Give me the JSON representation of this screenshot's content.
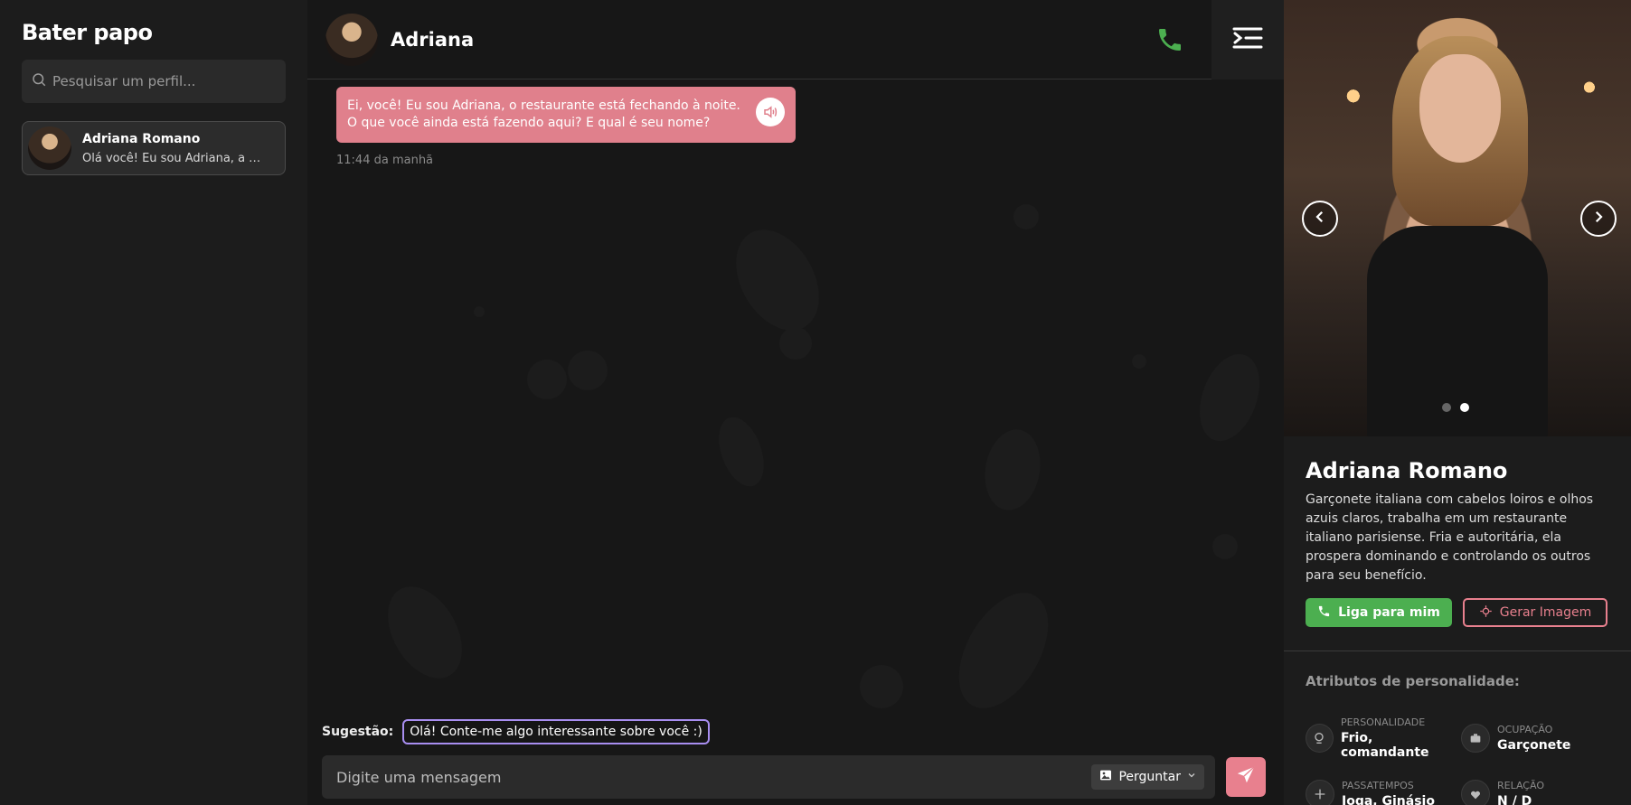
{
  "sidebar": {
    "title": "Bater papo",
    "search_placeholder": "Pesquisar um perfil...",
    "conversations": [
      {
        "name": "Adriana Romano",
        "preview": "Olá você! Eu sou Adriana, a r..."
      }
    ]
  },
  "chat": {
    "title": "Adriana",
    "messages": [
      {
        "text": "Ei, você! Eu sou Adriana, o restaurante está fechando à noite. O que você ainda está fazendo aqui? E qual é seu nome?",
        "time": "11:44 da manhã"
      }
    ],
    "suggestion_label": "Sugestão:",
    "suggestion_text": "Olá! Conte-me algo interessante sobre você :)",
    "input_placeholder": "Digite uma mensagem",
    "ask_label": "Perguntar"
  },
  "profile": {
    "name": "Adriana Romano",
    "description": "Garçonete italiana com cabelos loiros e olhos azuis claros, trabalha em um restaurante italiano parisiense. Fria e autoritária, ela prospera dominando e controlando os outros para seu benefício.",
    "call_label": "Liga para mim",
    "image_label": "Gerar Imagem",
    "attributes_title": "Atributos de personalidade:",
    "attributes": [
      {
        "key": "PERSONALIDADE",
        "value": "Frio, comandante",
        "icon": "personality-icon"
      },
      {
        "key": "OCUPAÇÃO",
        "value": "Garçonete",
        "icon": "occupation-icon"
      },
      {
        "key": "PASSATEMPOS",
        "value": "Ioga, Ginásio",
        "icon": "hobbies-icon"
      },
      {
        "key": "RELAÇÃO",
        "value": "N / D",
        "icon": "relationship-icon"
      }
    ]
  },
  "colors": {
    "accent_pink": "#e8808e",
    "message_bubble": "#e0808c",
    "call_green": "#4caf50",
    "suggestion_border": "#a88ef0"
  }
}
